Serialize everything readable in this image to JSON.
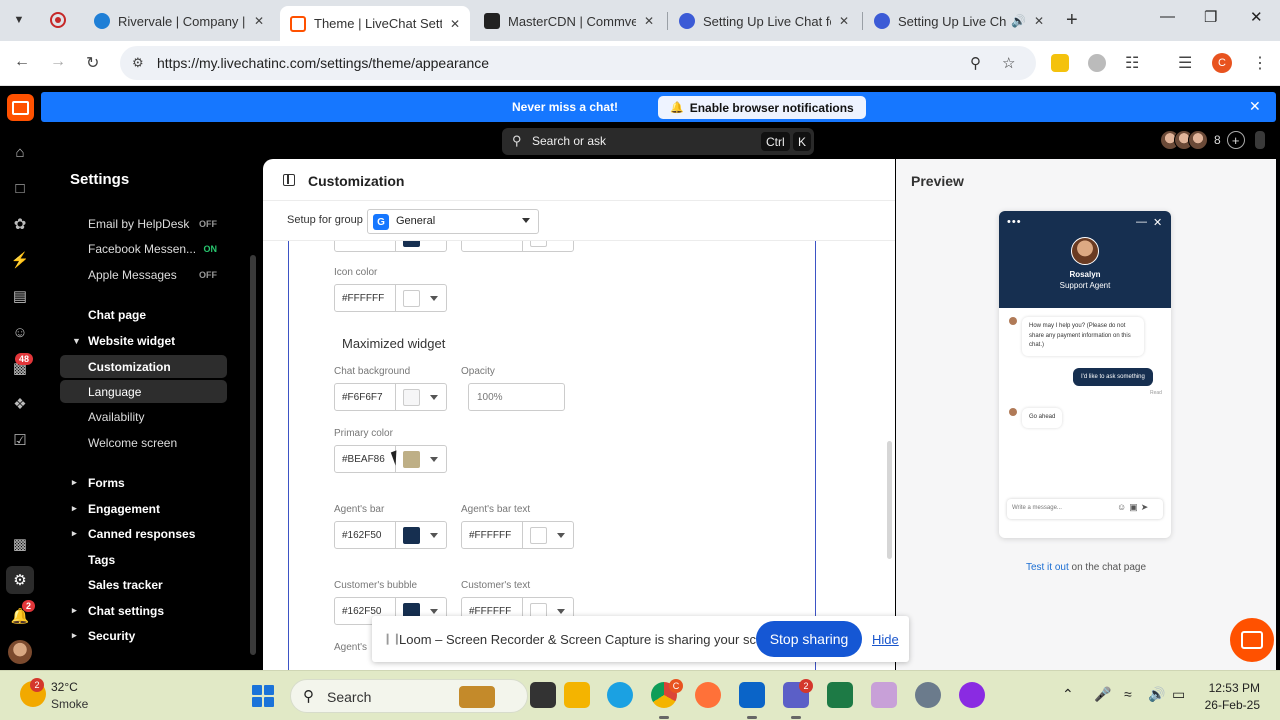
{
  "browser": {
    "tabs": [
      {
        "title": "Rivervale | Company | S",
        "active": false
      },
      {
        "title": "Theme | LiveChat Settin",
        "active": true
      },
      {
        "title": "MasterCDN | Commver",
        "active": false
      },
      {
        "title": "Setting Up Live Chat fo",
        "active": false
      },
      {
        "title": "Setting Up Live Cha",
        "active": false
      }
    ],
    "url": "https://my.livechatinc.com/settings/theme/appearance",
    "profile_initial": "C"
  },
  "notice": {
    "text": "Never miss a chat!",
    "button": "Enable browser notifications"
  },
  "search": {
    "placeholder": "Search or ask",
    "key1": "Ctrl",
    "key2": "K"
  },
  "agents": {
    "count": "8"
  },
  "rail": {
    "reports_badge": "48",
    "notifications_badge": "2"
  },
  "settings": {
    "title": "Settings",
    "items": [
      {
        "label": "Email by HelpDesk",
        "status": "OFF"
      },
      {
        "label": "Facebook Messen...",
        "status": "ON"
      },
      {
        "label": "Apple Messages",
        "status": "OFF"
      },
      {
        "label": "Chat page"
      },
      {
        "label": "Website widget"
      },
      {
        "label": "Customization"
      },
      {
        "label": "Language"
      },
      {
        "label": "Availability"
      },
      {
        "label": "Welcome screen"
      },
      {
        "label": "Forms"
      },
      {
        "label": "Engagement"
      },
      {
        "label": "Canned responses"
      },
      {
        "label": "Tags"
      },
      {
        "label": "Sales tracker"
      },
      {
        "label": "Chat settings"
      },
      {
        "label": "Security"
      }
    ]
  },
  "customization": {
    "title": "Customization",
    "group_label": "Setup for group",
    "group_badge": "G",
    "group_value": "General",
    "icon_color_label": "Icon color",
    "icon_color": "#FFFFFF",
    "maximized_title": "Maximized widget",
    "chat_bg_label": "Chat background",
    "chat_bg": "#F6F6F7",
    "opacity_label": "Opacity",
    "opacity_placeholder": "100%",
    "primary_label": "Primary color",
    "primary": "#BEAF86",
    "agent_bar_label": "Agent's bar",
    "agent_bar": "#162F50",
    "agent_bar_text_label": "Agent's bar text",
    "agent_bar_text": "#FFFFFF",
    "cust_bubble_label": "Customer's bubble",
    "cust_bubble": "#162F50",
    "cust_text_label": "Customer's text",
    "cust_text": "#FFFFFF",
    "agent_bubble_label": "Agent's"
  },
  "preview": {
    "title": "Preview",
    "agent_name": "Rosalyn",
    "agent_role": "Support Agent",
    "msg1": "How may I help you? (Please do not share any payment information on this chat.)",
    "msg2": "I'd like to ask something",
    "read": "Read",
    "msg3": "Go ahead",
    "input_placeholder": "Write a message...",
    "test_link": "Test it out",
    "test_rest": " on the chat page"
  },
  "loom": {
    "text": "Loom – Screen Recorder & Screen Capture is sharing your screen.",
    "stop": "Stop sharing",
    "hide": "Hide"
  },
  "taskbar": {
    "weather_badge": "2",
    "temp": "32°C",
    "condition": "Smoke",
    "search": "Search",
    "chrome_badge": "C",
    "teams_badge": "2",
    "time": "12:53 PM",
    "date": "26-Feb-25"
  },
  "colors": {
    "brand": "#FF5100",
    "notice": "#1677FF",
    "agent_bar": "#162F50",
    "primary": "#BEAF86",
    "chat_bg": "#F6F6F7"
  }
}
